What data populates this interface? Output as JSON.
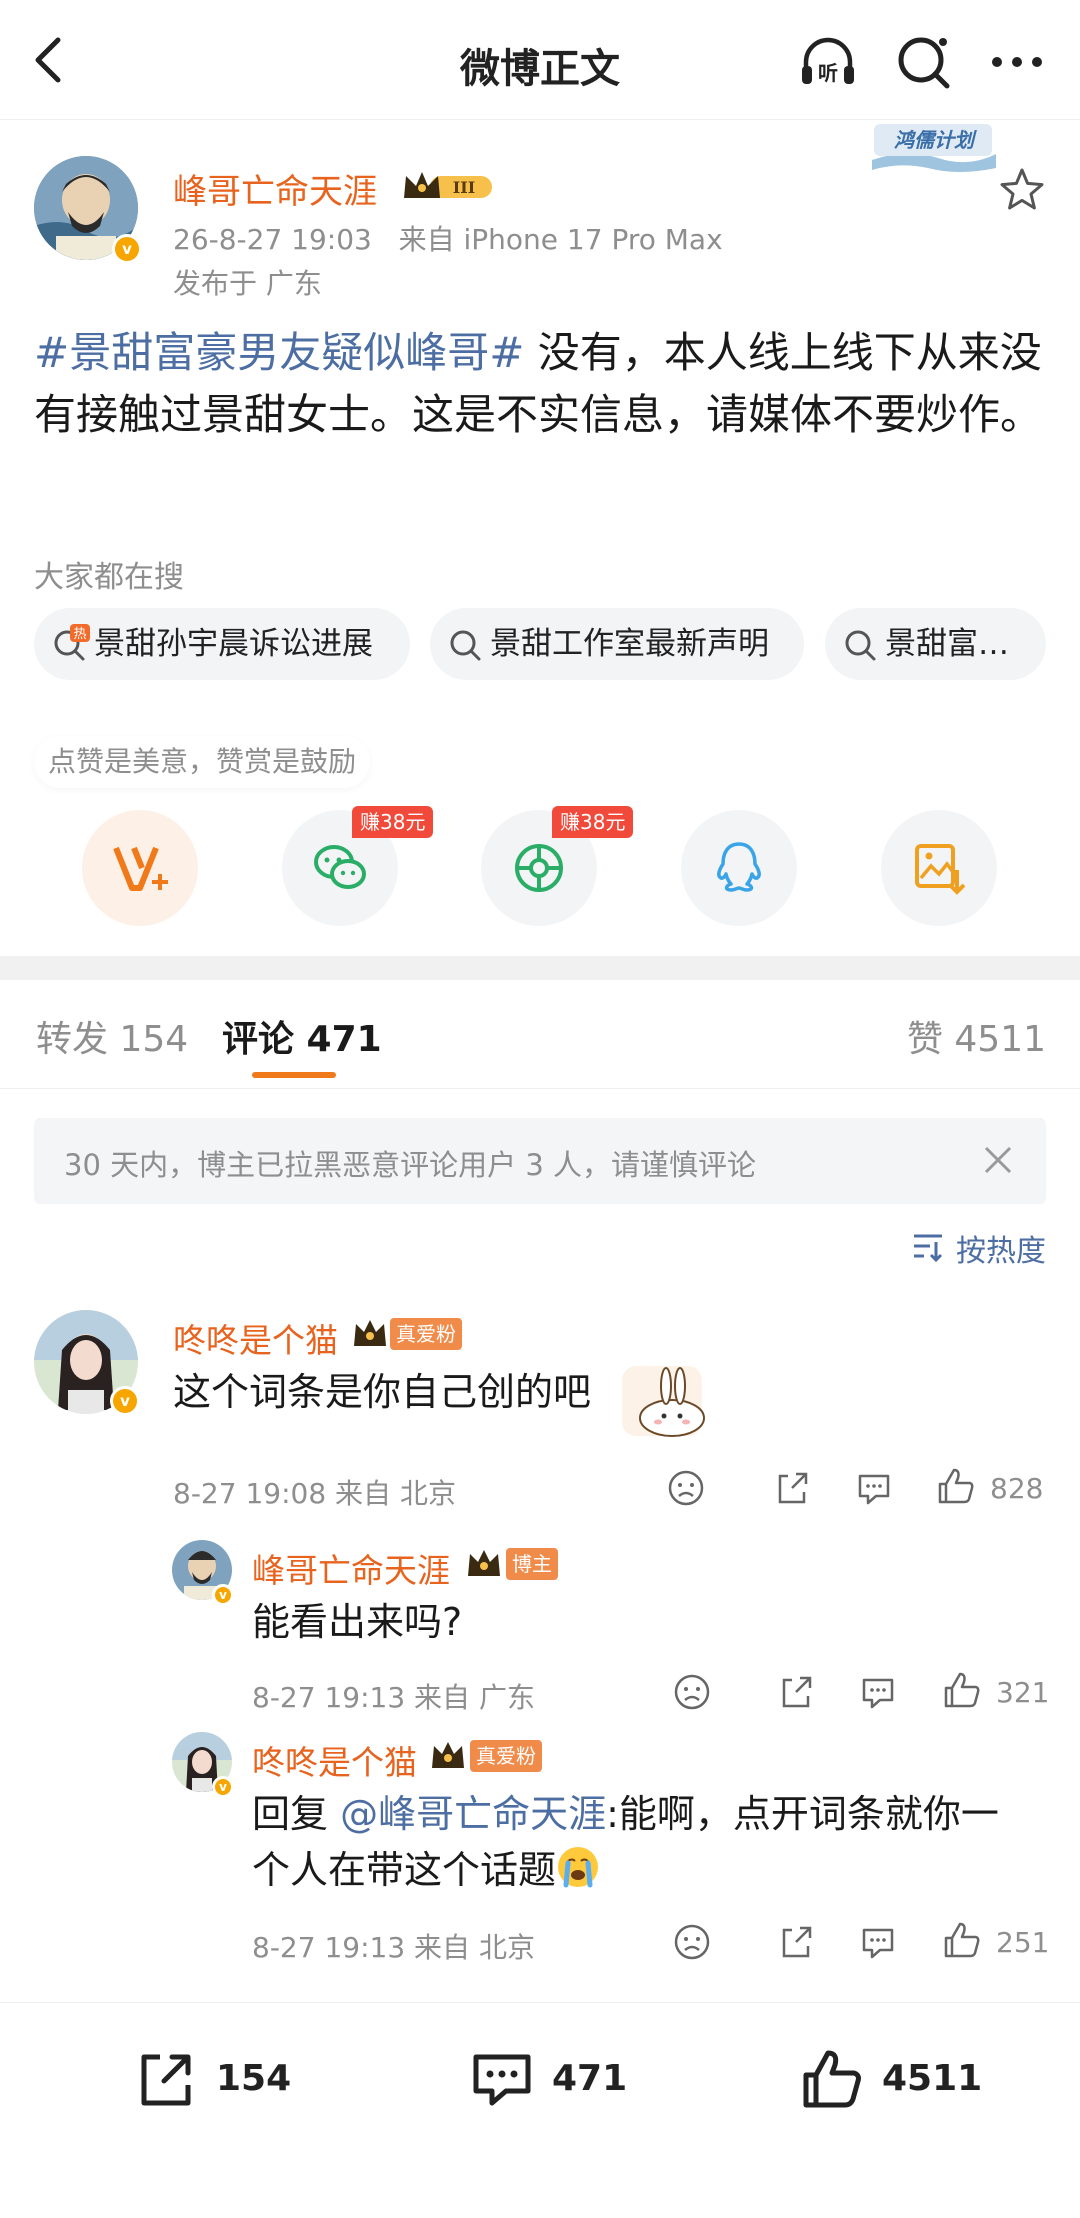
{
  "nav": {
    "title": "微博正文",
    "back_icon": "chevron-left-icon",
    "listen_icon": "headphones-icon",
    "listen_label": "听",
    "search_icon": "search-icon",
    "more_icon": "more-icon"
  },
  "post": {
    "author": "峰哥亡命天涯",
    "crown_level": "III",
    "time": "26-8-27 19:03",
    "source": "来自 iPhone 17 Pro Max",
    "location": "发布于 广东",
    "plan_badge": "鸿儒计划",
    "hashtag": "#景甜富豪男友疑似峰哥#",
    "text": " 没有，本人线上线下从来没有接触过景甜女士。这是不实信息，请媒体不要炒作。"
  },
  "hot_search": {
    "label": "大家都在搜",
    "chips": [
      "景甜孙宇晨诉讼进展",
      "景甜工作室最新声明",
      "景甜富…"
    ],
    "hot_badge": "热"
  },
  "share": {
    "hint": "点赞是美意，赞赏是鼓励",
    "earn_label": "赚38元",
    "icons": [
      "reward-v-icon",
      "wechat-icon",
      "moments-icon",
      "qq-icon",
      "save-image-icon"
    ]
  },
  "tabs": {
    "repost": "转发 154",
    "comment": "评论 471",
    "like": "赞 4511"
  },
  "notice": "30 天内，博主已拉黑恶意评论用户 3 人，请谨慎评论",
  "sort_label": "按热度",
  "comments": [
    {
      "name": "咚咚是个猫",
      "badge": "真爱粉",
      "text": "这个词条是你自己创的吧",
      "meta": "8-27 19:08 来自 北京",
      "likes": "828"
    },
    {
      "name": "峰哥亡命天涯",
      "badge": "博主",
      "text": "能看出来吗?",
      "meta": "8-27 19:13 来自 广东",
      "likes": "321"
    },
    {
      "name": "咚咚是个猫",
      "badge": "真爱粉",
      "reply_prefix": "回复 ",
      "reply_to": "@峰哥亡命天涯",
      "text": ":能啊，点开词条就你一个人在带这个话题",
      "meta": "8-27 19:13 来自 北京",
      "likes": "251"
    }
  ],
  "bottom": {
    "repost": "154",
    "comment": "471",
    "like": "4511"
  },
  "colors": {
    "name_orange": "#e8631e",
    "link_blue": "#4c6ea3",
    "accent_orange": "#f07a1a",
    "earn_red": "#f24a3a"
  }
}
